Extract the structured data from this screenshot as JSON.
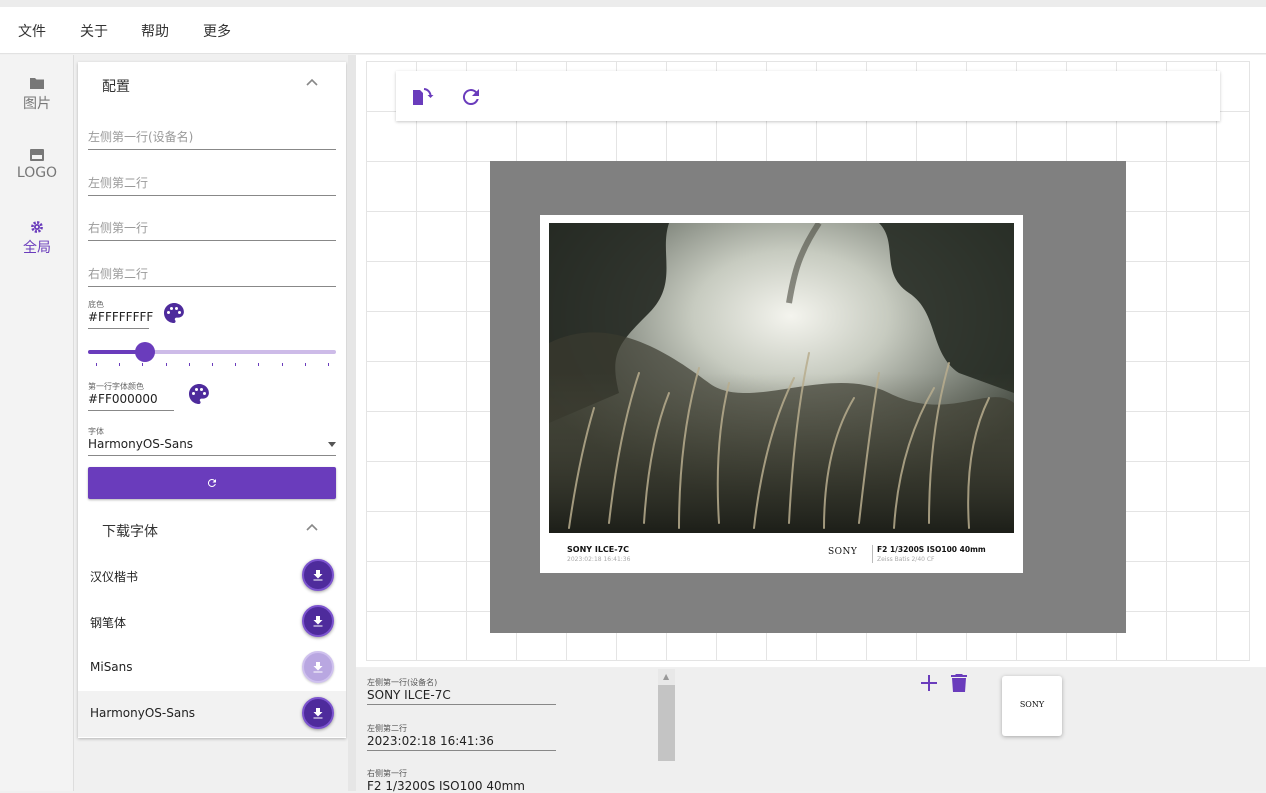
{
  "menu": [
    "文件",
    "关于",
    "帮助",
    "更多"
  ],
  "rail": [
    {
      "label": "图片",
      "icon": "folder-icon"
    },
    {
      "label": "LOGO",
      "icon": "logo-icon"
    },
    {
      "label": "全局",
      "icon": "gear-icon",
      "active": true
    }
  ],
  "config": {
    "title": "配置",
    "left_line1_placeholder": "左侧第一行(设备名)",
    "left_line2_placeholder": "左侧第二行",
    "right_line1_placeholder": "右侧第一行",
    "right_line2_placeholder": "右侧第二行",
    "bg_color_label": "底色",
    "bg_color_value": "#FFFFFFFF",
    "slider_value": 0.23,
    "first_line_color_label": "第一行字体颜色",
    "first_line_color_value": "#FF000000",
    "font_label": "字体",
    "font_value": "HarmonyOS-Sans",
    "reset_icon": "refresh-icon"
  },
  "download_fonts": {
    "title": "下载字体",
    "items": [
      {
        "name": "汉仪楷书",
        "enabled": true
      },
      {
        "name": "钢笔体",
        "enabled": true
      },
      {
        "name": "MiSans",
        "enabled": false
      },
      {
        "name": "HarmonyOS-Sans",
        "enabled": true,
        "selected": true
      }
    ]
  },
  "toolbar": {
    "rotate_icon": "rotate-icon",
    "refresh_icon": "refresh-icon"
  },
  "preview": {
    "left_line1": "SONY ILCE-7C",
    "left_line2": "2023:02:18 16:41:36",
    "logo_text": "SONY",
    "right_line1": "F2 1/3200S ISO100 40mm",
    "right_line2": "Zeiss Batis 2/40 CF"
  },
  "bottom": {
    "field1_label": "左侧第一行(设备名)",
    "field1_value": "SONY ILCE-7C",
    "field2_label": "左侧第二行",
    "field2_value": "2023:02:18 16:41:36",
    "field3_label": "右侧第一行",
    "field3_value": "F2 1/3200S ISO100 40mm",
    "logo_card_text": "SONY"
  },
  "colors": {
    "accent": "#6a3cbc",
    "accent_dark": "#4e2b9c",
    "frame_gray": "#808080"
  }
}
